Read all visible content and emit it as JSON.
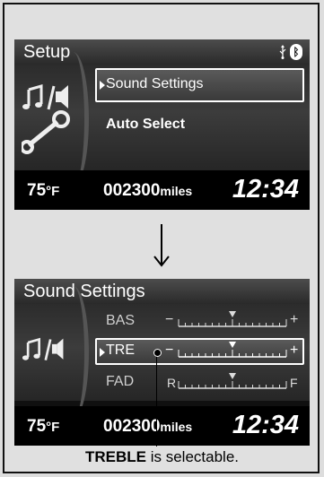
{
  "screen_setup": {
    "title": "Setup",
    "items": [
      "Sound Settings",
      "Auto Select"
    ],
    "selected_item": "Sound Settings"
  },
  "screen_sound": {
    "title": "Sound Settings",
    "rows": [
      {
        "label": "BAS",
        "left": "−",
        "right": "+"
      },
      {
        "label": "TRE",
        "left": "−",
        "right": "+"
      },
      {
        "label": "FAD",
        "left": "R",
        "right": "F"
      }
    ],
    "selected_row": "TRE"
  },
  "status": {
    "temperature": "75",
    "temperature_unit": "°F",
    "odometer": "002300",
    "odometer_unit": "miles",
    "clock": "12:34"
  },
  "caption": {
    "bold": "TREBLE",
    "rest": " is selectable."
  },
  "icons": [
    "usb-icon",
    "bluetooth-icon",
    "audio-settings-icon",
    "wrench-icon",
    "down-arrow-icon"
  ],
  "colors": {
    "screen_bg": "#101010",
    "highlight_border": "#ffffff",
    "page_bg": "#e0e0e0"
  }
}
